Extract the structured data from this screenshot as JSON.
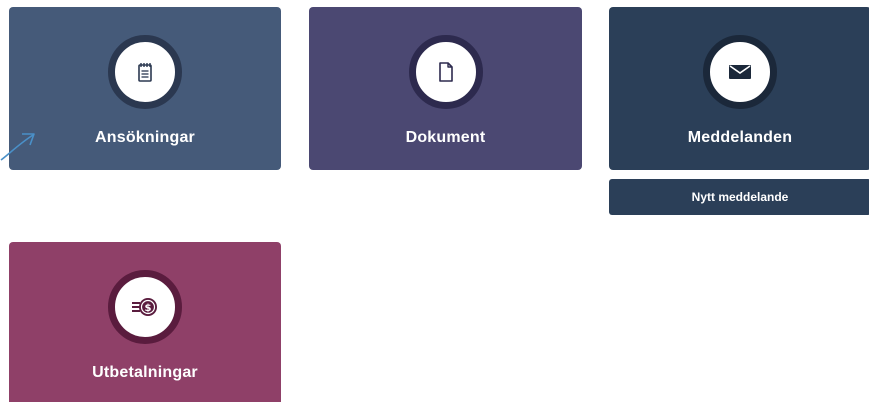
{
  "tiles": {
    "applications": {
      "label": "Ansökningar",
      "icon": "notepad-icon",
      "color": "#455a79"
    },
    "documents": {
      "label": "Dokument",
      "icon": "document-icon",
      "color": "#4b4872"
    },
    "messages": {
      "label": "Meddelanden",
      "icon": "envelope-icon",
      "color": "#2b3f58"
    },
    "payments": {
      "label": "Utbetalningar",
      "icon": "money-icon",
      "color": "#8f4068"
    }
  },
  "messages_actions": {
    "new_message_label": "Nytt meddelande"
  },
  "annotation": {
    "icon": "pointer-arrow-icon",
    "color": "#4a90c8"
  }
}
